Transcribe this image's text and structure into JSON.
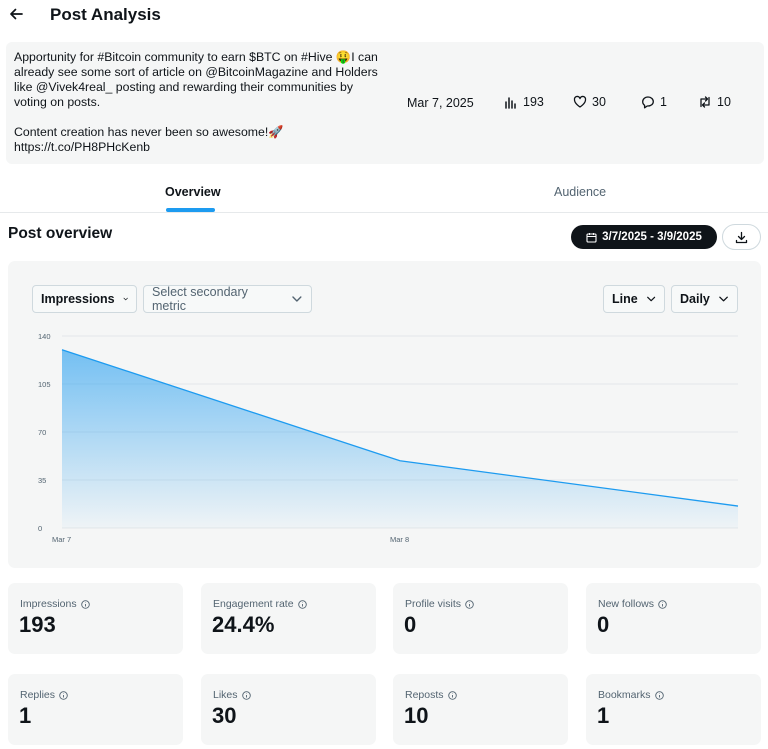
{
  "header": {
    "title": "Post Analysis",
    "back_icon": "arrow-left-icon"
  },
  "post": {
    "text": "Apportunity for #Bitcoin community to earn $BTC on #Hive 🤑I can already see some sort of article on @BitcoinMagazine and Holders like @Vivek4real_ posting and rewarding their communities by voting on posts.\n\nContent creation has never been so awesome!🚀\nhttps://t.co/PH8PHcKenb",
    "date": "Mar 7, 2025",
    "views": "193",
    "likes": "30",
    "replies": "1",
    "reposts": "10"
  },
  "tabs": [
    {
      "label": "Overview",
      "active": true
    },
    {
      "label": "Audience",
      "active": false
    }
  ],
  "overview": {
    "title": "Post overview",
    "date_range": "3/7/2025 - 3/9/2025",
    "primary_metric": "Impressions",
    "secondary_metric_placeholder": "Select secondary metric",
    "chart_type": "Line",
    "interval": "Daily"
  },
  "chart_data": {
    "type": "area",
    "x": [
      "Mar 7",
      "Mar 8",
      "Mar 9"
    ],
    "x_tick_labels": [
      "Mar 7",
      "Mar 8"
    ],
    "series": [
      {
        "values": [
          130,
          49,
          16
        ]
      }
    ],
    "y_ticks": [
      0,
      35,
      70,
      105,
      140
    ],
    "ylim": [
      0,
      140
    ],
    "grid": true,
    "color": "#1d9bf0"
  },
  "metrics": [
    {
      "label": "Impressions",
      "value": "193"
    },
    {
      "label": "Engagement rate",
      "value": "24.4%"
    },
    {
      "label": "Profile visits",
      "value": "0"
    },
    {
      "label": "New follows",
      "value": "0"
    },
    {
      "label": "Replies",
      "value": "1"
    },
    {
      "label": "Likes",
      "value": "30"
    },
    {
      "label": "Reposts",
      "value": "10"
    },
    {
      "label": "Bookmarks",
      "value": "1"
    }
  ]
}
